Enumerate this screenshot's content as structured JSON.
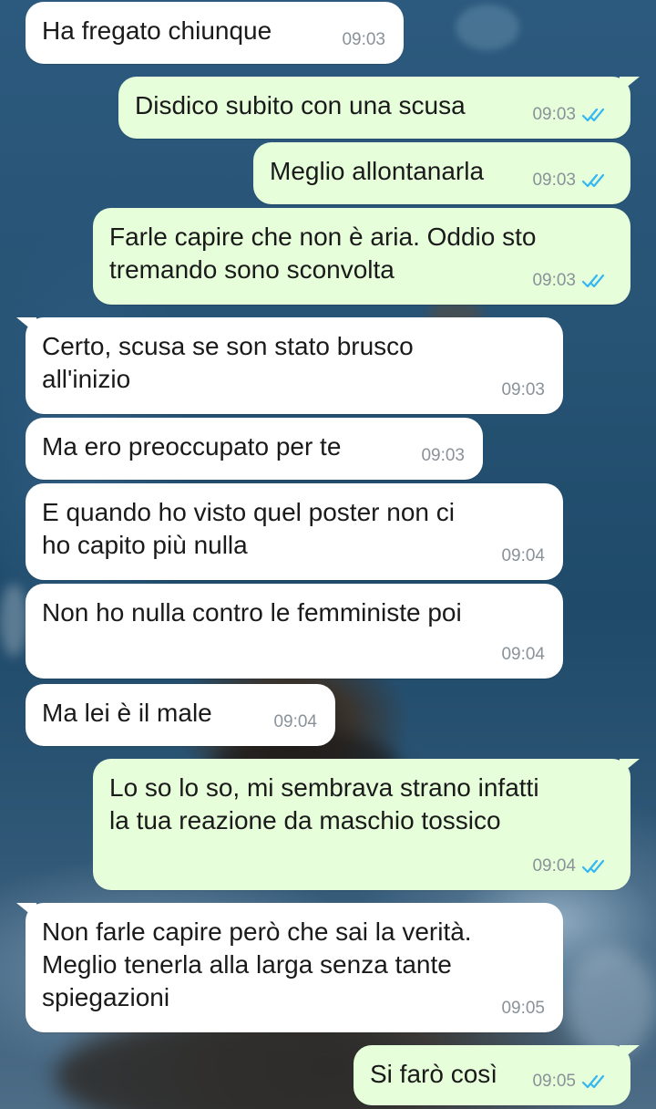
{
  "colors": {
    "incoming_bubble": "#ffffff",
    "outgoing_bubble": "#e6ffda",
    "timestamp": "#8a9299",
    "read_ticks": "#34b7f1"
  },
  "messages": [
    {
      "direction": "in",
      "text": "Ha fregato chiunque",
      "time": "09:03"
    },
    {
      "direction": "out",
      "text": "Disdico subito con una scusa",
      "time": "09:03",
      "status_icon": "double-check-read-icon"
    },
    {
      "direction": "out",
      "text": "Meglio allontanarla",
      "time": "09:03",
      "status_icon": "double-check-read-icon"
    },
    {
      "direction": "out",
      "text": "Farle capire che non è aria. Oddio sto\ntremando sono sconvolta",
      "time": "09:03",
      "status_icon": "double-check-read-icon"
    },
    {
      "direction": "in",
      "text": "Certo, scusa se son stato brusco\nall'inizio",
      "time": "09:03"
    },
    {
      "direction": "in",
      "text": "Ma ero preoccupato per te",
      "time": "09:03"
    },
    {
      "direction": "in",
      "text": "E quando ho visto quel poster non ci\nho capito più nulla",
      "time": "09:04"
    },
    {
      "direction": "in",
      "text": "Non ho nulla contro le femministe poi",
      "time": "09:04"
    },
    {
      "direction": "in",
      "text": "Ma lei è il male",
      "time": "09:04"
    },
    {
      "direction": "out",
      "text": "Lo so lo so, mi sembrava strano infatti\nla tua reazione da maschio tossico",
      "time": "09:04",
      "status_icon": "double-check-read-icon"
    },
    {
      "direction": "in",
      "text": "Non farle capire però che sai la verità.\nMeglio tenerla alla larga senza tante\nspiegazioni",
      "time": "09:05"
    },
    {
      "direction": "out",
      "text": "Si farò così",
      "time": "09:05",
      "status_icon": "double-check-read-icon"
    }
  ]
}
